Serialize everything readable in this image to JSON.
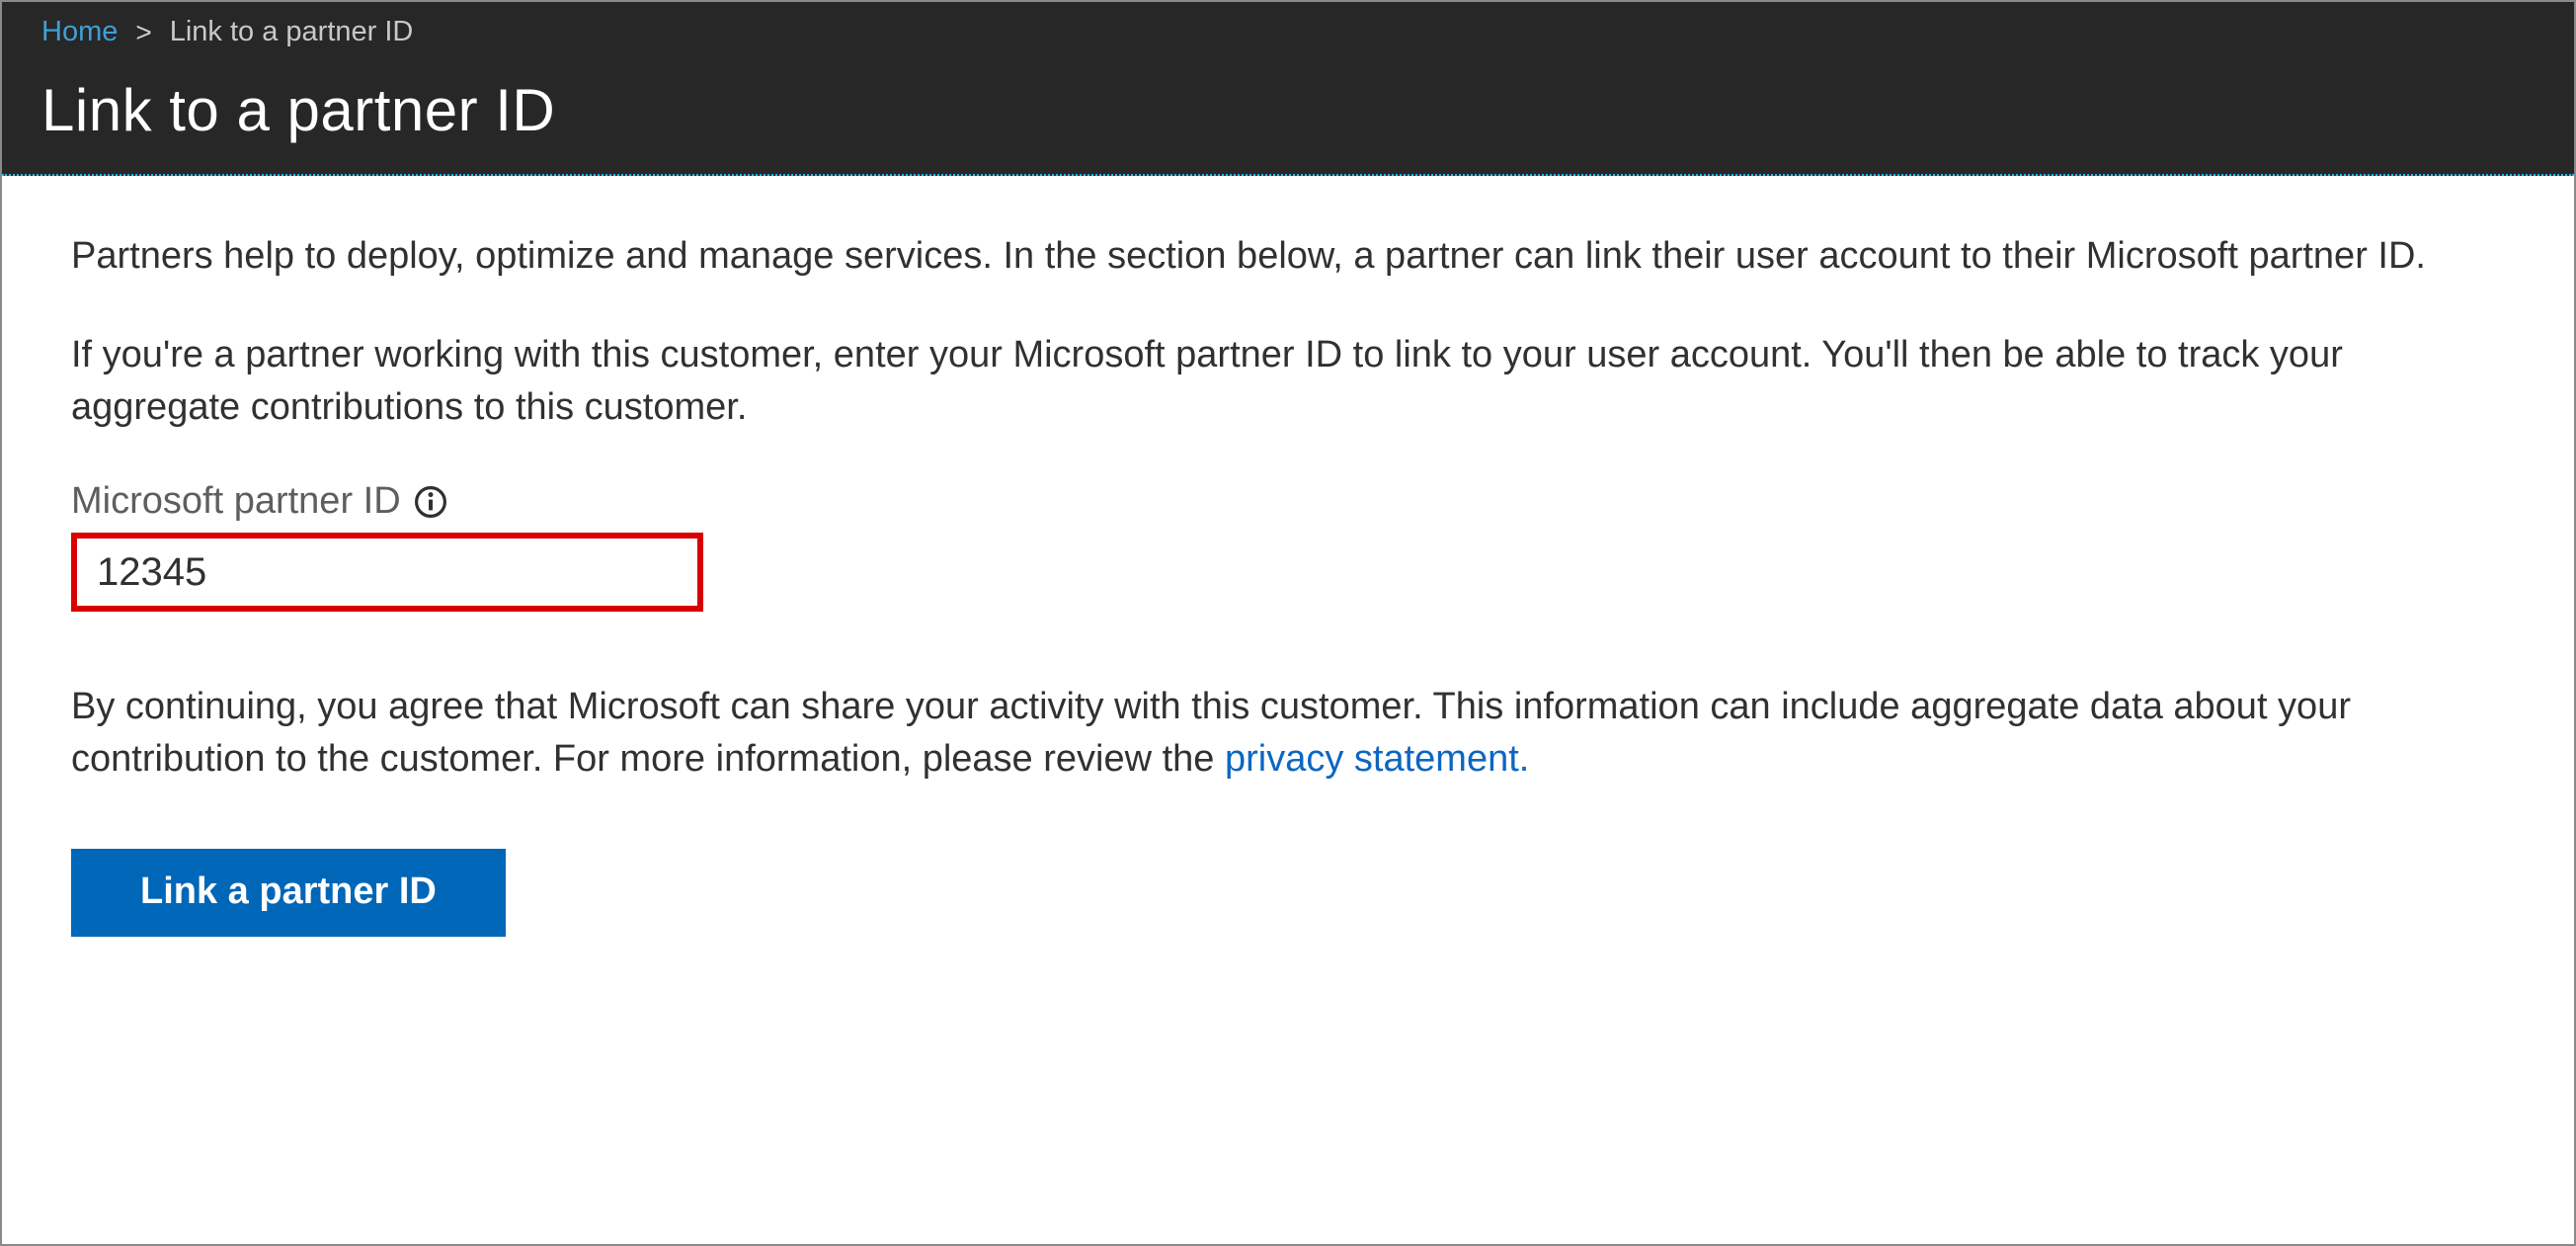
{
  "breadcrumb": {
    "home": "Home",
    "separator": ">",
    "current": "Link to a partner ID"
  },
  "page_title": "Link to a partner ID",
  "intro_para": "Partners help to deploy, optimize and manage services. In the section below, a partner can link their user account to their Microsoft partner ID.",
  "instruct_para": "If you're a partner working with this customer, enter your Microsoft partner ID to link to your user account. You'll then be able to track your aggregate contributions to this customer.",
  "field": {
    "label": "Microsoft partner ID",
    "value": "12345"
  },
  "agreement": {
    "prefix": "By continuing, you agree that Microsoft can share your activity with this customer. This information can include aggregate data about your contribution to the customer. For more information, please review the ",
    "link_text": "privacy statement.",
    "suffix": ""
  },
  "button_label": "Link a partner ID"
}
